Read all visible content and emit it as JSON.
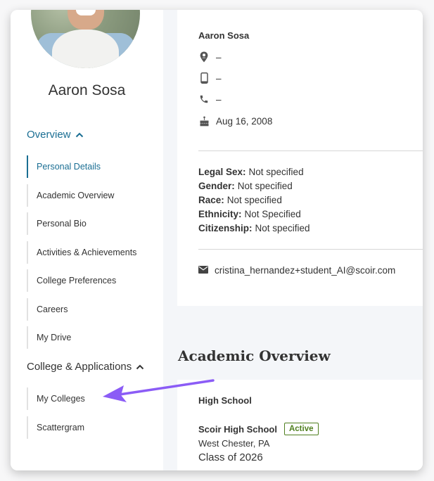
{
  "sidebar": {
    "student_name": "Aaron Sosa",
    "overview_section": {
      "label": "Overview",
      "expanded": true,
      "items": [
        {
          "label": "Personal Details",
          "active": true
        },
        {
          "label": "Academic Overview",
          "active": false
        },
        {
          "label": "Personal Bio",
          "active": false
        },
        {
          "label": "Activities & Achievements",
          "active": false
        },
        {
          "label": "College Preferences",
          "active": false
        },
        {
          "label": "Careers",
          "active": false
        },
        {
          "label": "My Drive",
          "active": false
        }
      ]
    },
    "colleges_section": {
      "label": "College & Applications",
      "expanded": true,
      "items": [
        {
          "label": "My Colleges",
          "active": false
        },
        {
          "label": "Scattergram",
          "active": false
        }
      ]
    }
  },
  "personal_details": {
    "name": "Aaron Sosa",
    "address": "–",
    "mobile": "–",
    "phone": "–",
    "birthday": "Aug 16, 2008",
    "fields": [
      {
        "label": "Legal Sex:",
        "value": "Not specified"
      },
      {
        "label": "Gender:",
        "value": "Not specified"
      },
      {
        "label": "Race:",
        "value": "Not specified"
      },
      {
        "label": "Ethnicity:",
        "value": "Not Specified"
      },
      {
        "label": "Citizenship:",
        "value": "Not specified"
      }
    ],
    "email": "cristina_hernandez+student_AI@scoir.com"
  },
  "academic_overview": {
    "title": "Academic Overview",
    "high_school_label": "High School",
    "school_name": "Scoir High School",
    "status_badge": "Active",
    "location": "West Chester, PA",
    "class_year": "Class of 2026"
  },
  "colors": {
    "accent": "#1a6e93",
    "badge_green": "#4f7f1f",
    "annotation_arrow": "#8b5cf6"
  }
}
